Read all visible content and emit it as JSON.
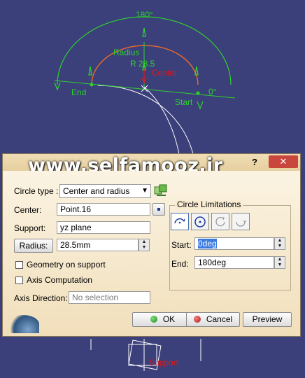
{
  "viewport": {
    "angle_label": "180°",
    "radius_label": "Radius",
    "radius_value": "R 28.5",
    "center_label": "Center",
    "end_label": "End",
    "start_label": "Start",
    "zero_label": "0°",
    "support_label": "Support"
  },
  "dialog": {
    "watermark": "www.selfamooz.ir",
    "help_glyph": "?",
    "close_glyph": "✕",
    "circle_type": {
      "label": "Circle type :",
      "value": "Center and radius"
    },
    "center": {
      "label": "Center:",
      "value": "Point.16"
    },
    "support": {
      "label": "Support:",
      "value": "yz plane"
    },
    "radius": {
      "button": "Radius:",
      "value": "28.5mm"
    },
    "geometry_on_support": {
      "label": "Geometry on support",
      "checked": false
    },
    "axis_computation": {
      "label": "Axis Computation",
      "checked": false
    },
    "axis_direction": {
      "label": "Axis Direction:",
      "placeholder": "No selection"
    },
    "limits": {
      "title": "Circle Limitations",
      "start": {
        "label": "Start:",
        "value": "0deg"
      },
      "end": {
        "label": "End:",
        "value": "180deg"
      },
      "modes": [
        "part-arc",
        "whole-circle",
        "trimmed-circle",
        "complementary-circle"
      ]
    },
    "buttons": {
      "ok": "OK",
      "cancel": "Cancel",
      "preview": "Preview"
    }
  },
  "colors": {
    "viewport_bg": "#3b3f7a",
    "geometry_green": "#2fd12f",
    "arc_orange": "#e06a2a",
    "center_red": "#e01919",
    "dialog_bg": "#f3e3c1",
    "close_red": "#c9463d",
    "selected_text_bg": "#3b7ae0"
  }
}
